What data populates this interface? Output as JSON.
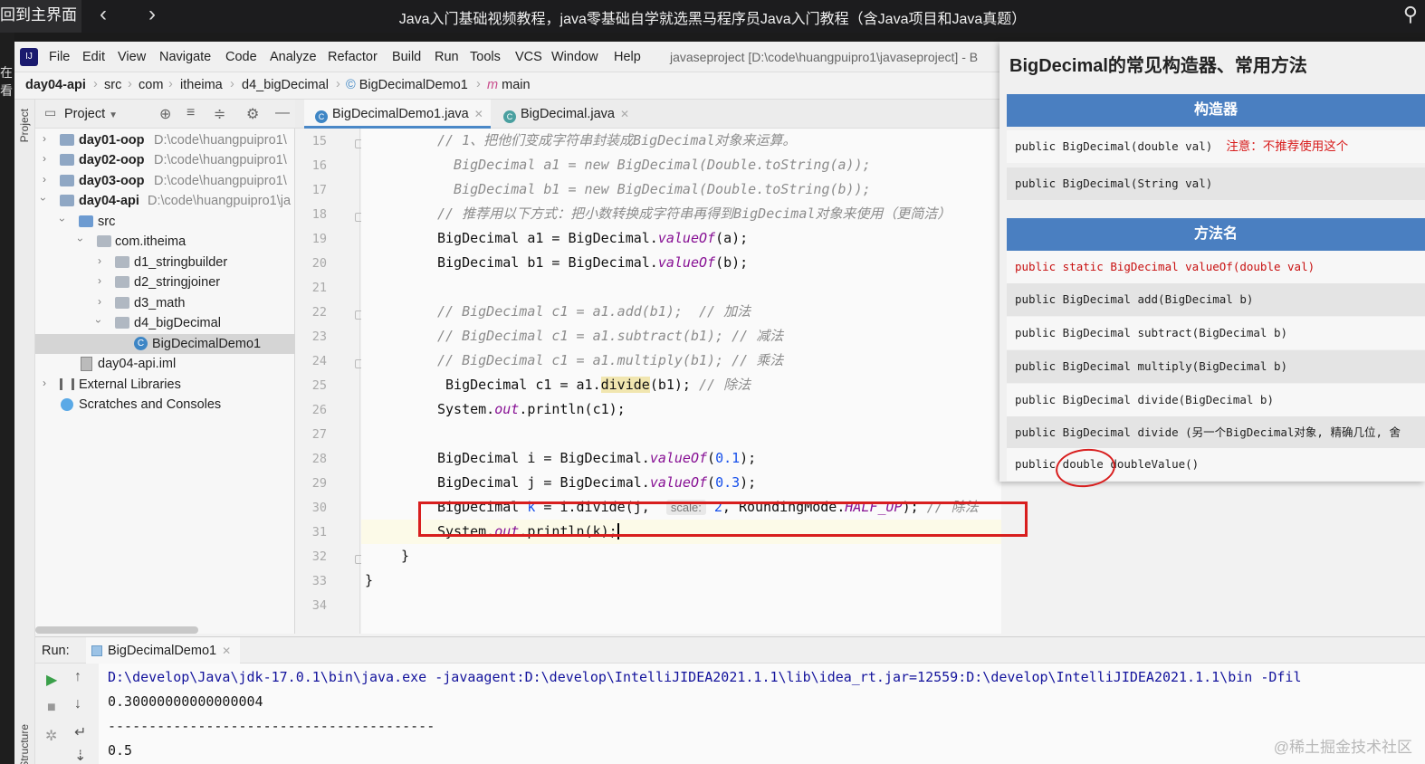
{
  "topbar": {
    "back_home": "回到主界面",
    "prev": "‹",
    "next": "›",
    "title": "Java入门基础视频教程，java零基础自学就选黑马程序员Java入门教程（含Java项目和Java真题）"
  },
  "side_strip_text": "在看",
  "menu": {
    "items": [
      "File",
      "Edit",
      "View",
      "Navigate",
      "Code",
      "Analyze",
      "Refactor",
      "Build",
      "Run",
      "Tools",
      "VCS",
      "Window",
      "Help"
    ],
    "project_title": "javaseproject [D:\\code\\huangpuipro1\\javaseproject] - B"
  },
  "breadcrumb": [
    "day04-api",
    "src",
    "com",
    "itheima",
    "d4_bigDecimal",
    "BigDecimalDemo1",
    "main"
  ],
  "toolstrip": {
    "project": "Project",
    "structure": "Structure"
  },
  "project_panel": {
    "header": "Project",
    "tree": [
      {
        "name": "day01-oop",
        "path": "D:\\code\\huangpuipro1\\"
      },
      {
        "name": "day02-oop",
        "path": "D:\\code\\huangpuipro1\\"
      },
      {
        "name": "day03-oop",
        "path": "D:\\code\\huangpuipro1\\"
      },
      {
        "name": "day04-api",
        "path": "D:\\code\\huangpuipro1\\ja"
      },
      {
        "name": "src",
        "path": ""
      },
      {
        "name": "com.itheima",
        "path": ""
      },
      {
        "name": "d1_stringbuilder",
        "path": ""
      },
      {
        "name": "d2_stringjoiner",
        "path": ""
      },
      {
        "name": "d3_math",
        "path": ""
      },
      {
        "name": "d4_bigDecimal",
        "path": ""
      },
      {
        "name": "BigDecimalDemo1",
        "path": ""
      },
      {
        "name": "day04-api.iml",
        "path": ""
      },
      {
        "name": "External Libraries",
        "path": ""
      },
      {
        "name": "Scratches and Consoles",
        "path": ""
      }
    ]
  },
  "editor": {
    "tabs": [
      "BigDecimalDemo1.java",
      "BigDecimal.java"
    ],
    "line_numbers": [
      "15",
      "16",
      "17",
      "18",
      "19",
      "20",
      "21",
      "22",
      "23",
      "24",
      "25",
      "26",
      "27",
      "28",
      "29",
      "30",
      "31",
      "32",
      "33",
      "34"
    ],
    "lines": {
      "l15": "// 1、把他们变成字符串封装成BigDecimal对象来运算。",
      "l16": "  BigDecimal a1 = new BigDecimal(Double.toString(a));",
      "l17": "  BigDecimal b1 = new BigDecimal(Double.toString(b));",
      "l18": "// 推荐用以下方式：把小数转换成字符串再得到BigDecimal对象来使用（更简洁）",
      "l22": "// BigDecimal c1 = a1.add(b1);  // 加法",
      "l23": "// BigDecimal c1 = a1.subtract(b1); // 减法",
      "l24": "// BigDecimal c1 = a1.multiply(b1); // 乘法",
      "l25_comment": "// 除法",
      "l30_comment": "// 除法",
      "hint_scale": "scale:",
      "line_comment_mark": "//"
    }
  },
  "run": {
    "label": "Run:",
    "tab": "BigDecimalDemo1",
    "output": [
      "D:\\develop\\Java\\jdk-17.0.1\\bin\\java.exe -javaagent:D:\\develop\\IntelliJIDEA2021.1.1\\lib\\idea_rt.jar=12559:D:\\develop\\IntelliJIDEA2021.1.1\\bin -Dfil",
      "0.30000000000000004",
      "----------------------------------------",
      "0.5"
    ]
  },
  "slide": {
    "title": "BigDecimal的常见构造器、常用方法",
    "constructors_header": "构造器",
    "constructors": [
      {
        "sig": "public BigDecimal(double val)",
        "note": "注意：不推荐使用这个"
      },
      {
        "sig": "public BigDecimal(String val)",
        "note": ""
      }
    ],
    "methods_header": "方法名",
    "methods": [
      "public static BigDecimal valueOf(double val)",
      "public BigDecimal add(BigDecimal b)",
      "public BigDecimal subtract(BigDecimal b)",
      "public BigDecimal multiply(BigDecimal b)",
      "public BigDecimal divide(BigDecimal b)",
      "public BigDecimal divide (另一个BigDecimal对象, 精确几位, 舍",
      "public double doubleValue()"
    ]
  },
  "watermark": "@稀土掘金技术社区"
}
